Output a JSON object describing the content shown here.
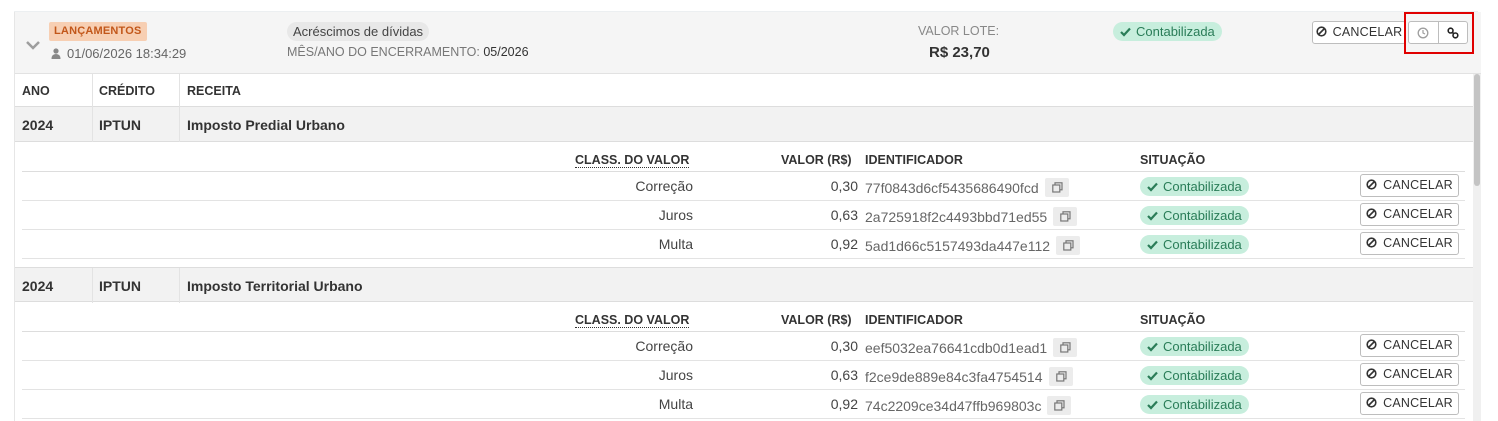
{
  "header": {
    "tag": "LANÇAMENTOS",
    "datetime": "01/06/2026 18:34:29",
    "description_pill": "Acréscimos de dívidas",
    "closing_label": "MÊS/ANO DO ENCERRAMENTO:",
    "closing_value": "05/2026",
    "lot_value_label": "VALOR LOTE:",
    "lot_value": "R$ 23,70",
    "status": "Contabilizada",
    "cancel_label": "CANCELAR",
    "icons": [
      "chevron-down-icon",
      "user-icon",
      "check-icon",
      "ban-icon",
      "clock-icon",
      "link-icon"
    ]
  },
  "table": {
    "columns": [
      "ANO",
      "CRÉDITO",
      "RECEITA"
    ],
    "detail_columns": [
      "CLASS. DO VALOR",
      "VALOR (R$)",
      "IDENTIFICADOR",
      "SITUAÇÃO"
    ],
    "groups": [
      {
        "year": "2024",
        "credit": "IPTUN",
        "revenue": "Imposto Predial Urbano",
        "rows": [
          {
            "class": "Correção",
            "value": "0,30",
            "id": "77f0843d6cf5435686490fcd",
            "status": "Contabilizada",
            "action": "CANCELAR"
          },
          {
            "class": "Juros",
            "value": "0,63",
            "id": "2a725918f2c4493bbd71ed55",
            "status": "Contabilizada",
            "action": "CANCELAR"
          },
          {
            "class": "Multa",
            "value": "0,92",
            "id": "5ad1d66c5157493da447e112",
            "status": "Contabilizada",
            "action": "CANCELAR"
          }
        ]
      },
      {
        "year": "2024",
        "credit": "IPTUN",
        "revenue": "Imposto Territorial Urbano",
        "rows": [
          {
            "class": "Correção",
            "value": "0,30",
            "id": "eef5032ea76641cdb0d1ead1",
            "status": "Contabilizada",
            "action": "CANCELAR"
          },
          {
            "class": "Juros",
            "value": "0,63",
            "id": "f2ce9de889e84c3fa4754514",
            "status": "Contabilizada",
            "action": "CANCELAR"
          },
          {
            "class": "Multa",
            "value": "0,92",
            "id": "74c2209ce34d47ffb969803c",
            "status": "Contabilizada",
            "action": "CANCELAR"
          }
        ]
      }
    ]
  },
  "colors": {
    "tag_bg": "#f7cfb3",
    "tag_text": "#c2571a",
    "status_bg": "#c7eedd",
    "status_text": "#2a7d58",
    "highlight": "#e00000"
  }
}
